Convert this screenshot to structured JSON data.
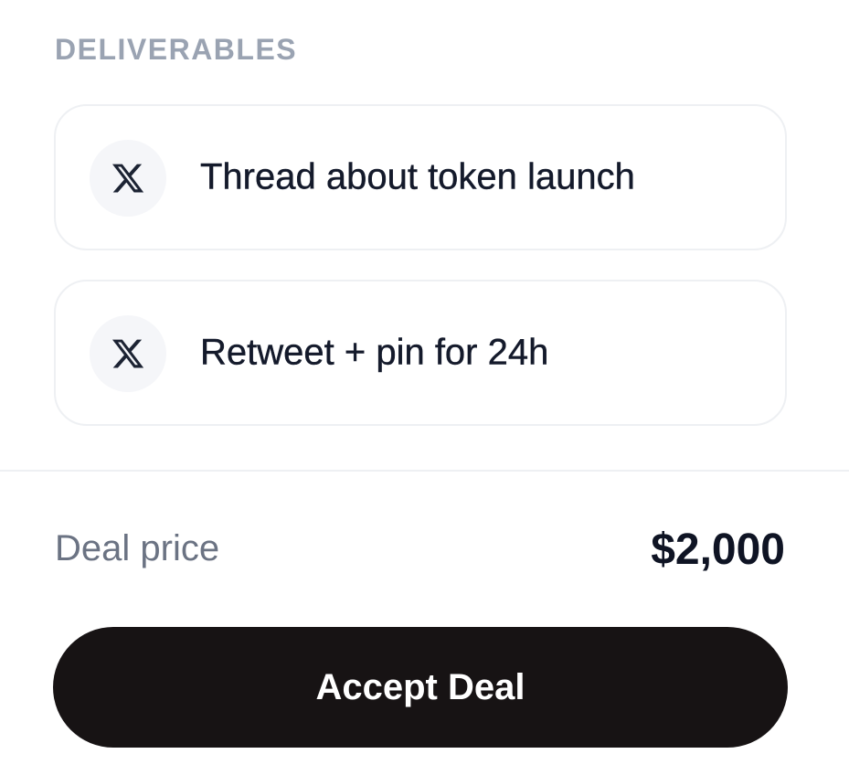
{
  "deliverables": {
    "heading": "DELIVERABLES",
    "items": [
      {
        "icon": "x-logo-icon",
        "label": "Thread about token launch"
      },
      {
        "icon": "x-logo-icon",
        "label": "Retweet + pin for 24h"
      }
    ]
  },
  "price": {
    "label": "Deal price",
    "value": "$2,000"
  },
  "actions": {
    "accept_label": "Accept Deal"
  },
  "colors": {
    "heading": "#9aa3b2",
    "card_border": "#eef0f3",
    "icon_bg": "#f5f6f9",
    "button_bg": "#171314",
    "button_text": "#ffffff"
  }
}
